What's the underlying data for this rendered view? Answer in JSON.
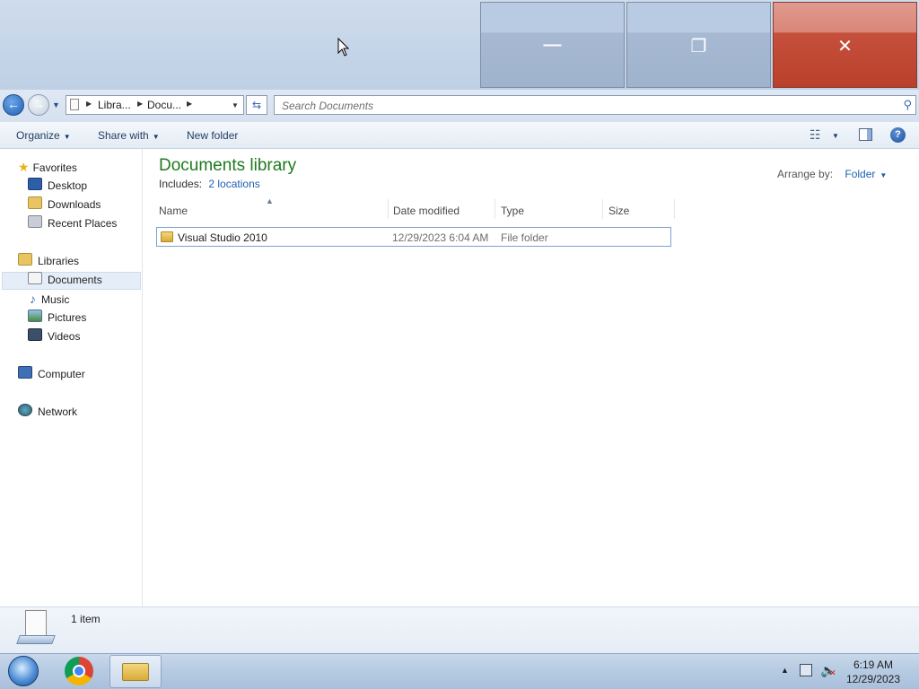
{
  "window": {
    "minimize_glyph": "—",
    "restore_glyph": "❐",
    "close_glyph": "✕"
  },
  "address": {
    "crumbs": [
      "Libra...",
      "Docu..."
    ],
    "search_placeholder": "Search Documents"
  },
  "toolbar": {
    "organize": "Organize",
    "share_with": "Share with",
    "new_folder": "New folder"
  },
  "nav": {
    "favorites": "Favorites",
    "desktop": "Desktop",
    "downloads": "Downloads",
    "recent_places": "Recent Places",
    "libraries": "Libraries",
    "documents": "Documents",
    "music": "Music",
    "pictures": "Pictures",
    "videos": "Videos",
    "computer": "Computer",
    "network": "Network"
  },
  "library": {
    "title": "Documents library",
    "includes_label": "Includes:",
    "locations": "2 locations",
    "arrange_label": "Arrange by:",
    "arrange_value": "Folder"
  },
  "columns": {
    "name": "Name",
    "date_modified": "Date modified",
    "type": "Type",
    "size": "Size"
  },
  "rows": [
    {
      "name": "Visual Studio 2010",
      "date": "12/29/2023 6:04 AM",
      "type": "File folder",
      "size": ""
    }
  ],
  "status": {
    "item_count": "1 item"
  },
  "taskbar": {
    "time": "6:19 AM",
    "date": "12/29/2023"
  },
  "colors": {
    "library_title": "#1e7a1e",
    "link": "#1f5fb0",
    "close_button": "#c5503b"
  }
}
